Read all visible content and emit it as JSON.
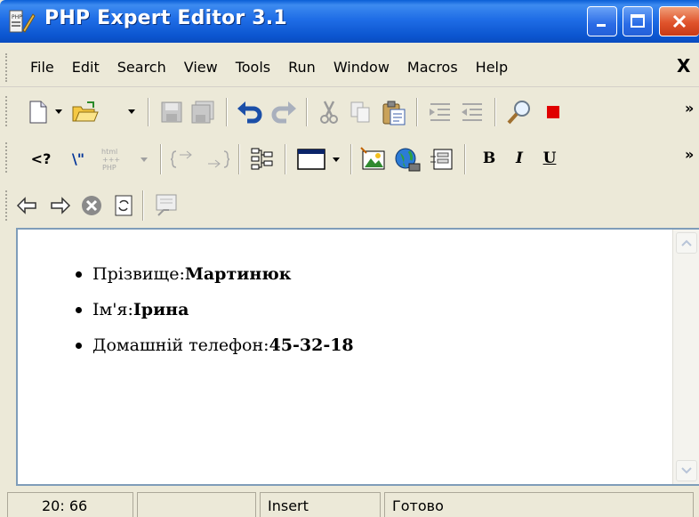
{
  "window": {
    "title": "PHP Expert Editor 3.1"
  },
  "menu": {
    "items": [
      "File",
      "Edit",
      "Search",
      "View",
      "Tools",
      "Run",
      "Window",
      "Macros",
      "Help"
    ],
    "close_glyph": "X"
  },
  "toolbar": {
    "overflow_glyph": "»",
    "html_php_glyph": "html +++ PHP",
    "bold_label": "B",
    "italic_label": "I",
    "underline_label": "U",
    "php_tag_label": "<?",
    "escape_label": "\\\""
  },
  "editor": {
    "items": [
      {
        "label": "Прізвище:",
        "value": "Мартинюк"
      },
      {
        "label": "Ім'я:",
        "value": "Ірина"
      },
      {
        "label": "Домашній телефон:",
        "value": "45-32-18"
      }
    ]
  },
  "statusbar": {
    "position": "20: 66",
    "empty": "",
    "mode": "Insert",
    "state": "Готово"
  },
  "colors": {
    "titlebar": "#0b55cf",
    "stop": "#e00000",
    "close_button": "#e0532b"
  }
}
